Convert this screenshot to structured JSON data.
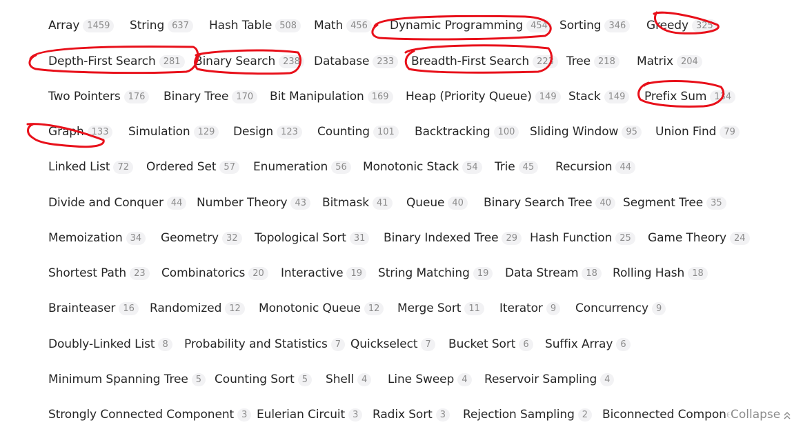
{
  "colors": {
    "tag_text": "#262626",
    "count_text": "#8c8c8c",
    "count_bg": "#f2f2f4",
    "annotation": "#e8101a"
  },
  "rows": [
    [
      {
        "name": "Array",
        "count": "1459"
      },
      {
        "name": "String",
        "count": "637"
      },
      {
        "name": "Hash Table",
        "count": "508"
      },
      {
        "name": "Math",
        "count": "456"
      },
      {
        "name": "Dynamic Programming",
        "count": "454"
      },
      {
        "name": "Sorting",
        "count": "346"
      },
      {
        "name": "Greedy",
        "count": "325"
      }
    ],
    [
      {
        "name": "Depth-First Search",
        "count": "281"
      },
      {
        "name": "Binary Search",
        "count": "238"
      },
      {
        "name": "Database",
        "count": "233"
      },
      {
        "name": "Breadth-First Search",
        "count": "223"
      },
      {
        "name": "Tree",
        "count": "218"
      },
      {
        "name": "Matrix",
        "count": "204"
      }
    ],
    [
      {
        "name": "Two Pointers",
        "count": "176"
      },
      {
        "name": "Binary Tree",
        "count": "170"
      },
      {
        "name": "Bit Manipulation",
        "count": "169"
      },
      {
        "name": "Heap (Priority Queue)",
        "count": "149"
      },
      {
        "name": "Stack",
        "count": "149"
      },
      {
        "name": "Prefix Sum",
        "count": "134"
      }
    ],
    [
      {
        "name": "Graph",
        "count": "133"
      },
      {
        "name": "Simulation",
        "count": "129"
      },
      {
        "name": "Design",
        "count": "123"
      },
      {
        "name": "Counting",
        "count": "101"
      },
      {
        "name": "Backtracking",
        "count": "100"
      },
      {
        "name": "Sliding Window",
        "count": "95"
      },
      {
        "name": "Union Find",
        "count": "79"
      }
    ],
    [
      {
        "name": "Linked List",
        "count": "72"
      },
      {
        "name": "Ordered Set",
        "count": "57"
      },
      {
        "name": "Enumeration",
        "count": "56"
      },
      {
        "name": "Monotonic Stack",
        "count": "54"
      },
      {
        "name": "Trie",
        "count": "45"
      },
      {
        "name": "Recursion",
        "count": "44"
      }
    ],
    [
      {
        "name": "Divide and Conquer",
        "count": "44"
      },
      {
        "name": "Number Theory",
        "count": "43"
      },
      {
        "name": "Bitmask",
        "count": "41"
      },
      {
        "name": "Queue",
        "count": "40"
      },
      {
        "name": "Binary Search Tree",
        "count": "40"
      },
      {
        "name": "Segment Tree",
        "count": "35"
      }
    ],
    [
      {
        "name": "Memoization",
        "count": "34"
      },
      {
        "name": "Geometry",
        "count": "32"
      },
      {
        "name": "Topological Sort",
        "count": "31"
      },
      {
        "name": "Binary Indexed Tree",
        "count": "29"
      },
      {
        "name": "Hash Function",
        "count": "25"
      },
      {
        "name": "Game Theory",
        "count": "24"
      }
    ],
    [
      {
        "name": "Shortest Path",
        "count": "23"
      },
      {
        "name": "Combinatorics",
        "count": "20"
      },
      {
        "name": "Interactive",
        "count": "19"
      },
      {
        "name": "String Matching",
        "count": "19"
      },
      {
        "name": "Data Stream",
        "count": "18"
      },
      {
        "name": "Rolling Hash",
        "count": "18"
      }
    ],
    [
      {
        "name": "Brainteaser",
        "count": "16"
      },
      {
        "name": "Randomized",
        "count": "12"
      },
      {
        "name": "Monotonic Queue",
        "count": "12"
      },
      {
        "name": "Merge Sort",
        "count": "11"
      },
      {
        "name": "Iterator",
        "count": "9"
      },
      {
        "name": "Concurrency",
        "count": "9"
      }
    ],
    [
      {
        "name": "Doubly-Linked List",
        "count": "8"
      },
      {
        "name": "Probability and Statistics",
        "count": "7"
      },
      {
        "name": "Quickselect",
        "count": "7"
      },
      {
        "name": "Bucket Sort",
        "count": "6"
      },
      {
        "name": "Suffix Array",
        "count": "6"
      }
    ],
    [
      {
        "name": "Minimum Spanning Tree",
        "count": "5"
      },
      {
        "name": "Counting Sort",
        "count": "5"
      },
      {
        "name": "Shell",
        "count": "4"
      },
      {
        "name": "Line Sweep",
        "count": "4"
      },
      {
        "name": "Reservoir Sampling",
        "count": "4"
      }
    ],
    [
      {
        "name": "Strongly Connected Component",
        "count": "3"
      },
      {
        "name": "Eulerian Circuit",
        "count": "3"
      },
      {
        "name": "Radix Sort",
        "count": "3"
      },
      {
        "name": "Rejection Sampling",
        "count": "2"
      },
      {
        "name": "Biconnected Component",
        "count": ""
      }
    ]
  ],
  "collapse": {
    "label": "Collapse",
    "icon": "double-chevron-up-icon"
  },
  "annotations": {
    "shape": "hand-drawn-circle",
    "circled_tags": [
      "Dynamic Programming",
      "Greedy",
      "Depth-First Search",
      "Binary Search",
      "Breadth-First Search",
      "Prefix Sum",
      "Graph"
    ]
  }
}
